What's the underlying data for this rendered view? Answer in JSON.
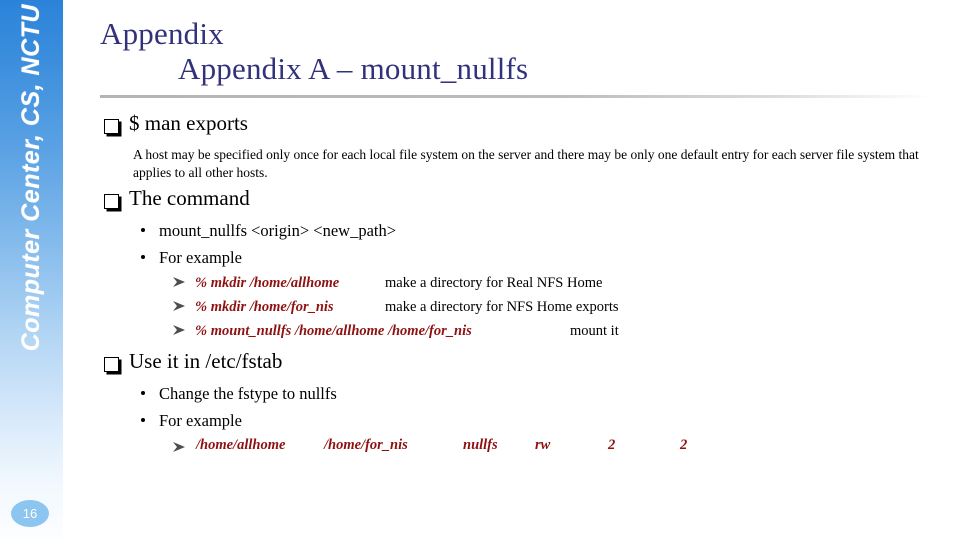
{
  "slide": {
    "sidebar_label": "Computer Center, CS, NCTU",
    "page_number": "16",
    "accent_blue": "#2b83d9",
    "title_color": "#32327a",
    "code_red": "#8e1111"
  },
  "title": {
    "line1": "Appendix",
    "line2": "Appendix A – mount_nullfs"
  },
  "sections": [
    {
      "heading": "$ man exports",
      "paragraph": "A host may be specified only once for each local file system on the server and there may be only one default entry for each server file system that applies to all other hosts."
    },
    {
      "heading": "The command",
      "bullets": [
        "mount_nullfs <origin> <new_path>",
        "For example"
      ],
      "examples": [
        {
          "cmd": "% mkdir /home/allhome",
          "desc": "make a directory for Real NFS Home"
        },
        {
          "cmd": "% mkdir /home/for_nis",
          "desc": "make a directory for NFS Home exports"
        },
        {
          "cmd": "% mount_nullfs /home/allhome  /home/for_nis",
          "desc": "mount it"
        }
      ]
    },
    {
      "heading": "Use it in /etc/fstab",
      "bullets": [
        "Change the fstype to nullfs",
        "For example"
      ],
      "fstab_entry": {
        "device": "/home/allhome",
        "mountpoint": "/home/for_nis",
        "fstype": "nullfs",
        "options": "rw",
        "dump": "2",
        "pass": "2"
      }
    }
  ]
}
